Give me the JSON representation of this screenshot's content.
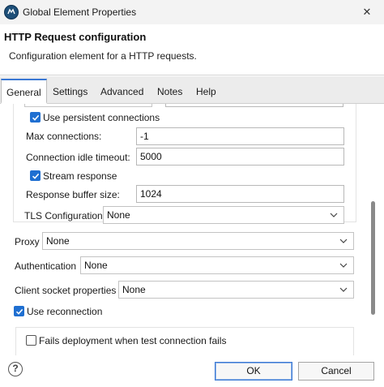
{
  "window": {
    "title": "Global Element Properties",
    "close_glyph": "✕"
  },
  "header": {
    "title": "HTTP Request configuration",
    "description": "Configuration element for a HTTP requests."
  },
  "tabs": [
    {
      "label": "General",
      "active": true
    },
    {
      "label": "Settings",
      "active": false
    },
    {
      "label": "Advanced",
      "active": false
    },
    {
      "label": "Notes",
      "active": false
    },
    {
      "label": "Help",
      "active": false
    }
  ],
  "form": {
    "use_persistent_connections": {
      "label": "Use persistent connections",
      "checked": true
    },
    "max_connections": {
      "label": "Max connections:",
      "value": "-1"
    },
    "connection_idle_timeout": {
      "label": "Connection idle timeout:",
      "value": "5000"
    },
    "stream_response": {
      "label": "Stream response",
      "checked": true
    },
    "response_buffer_size": {
      "label": "Response buffer size:",
      "value": "1024"
    },
    "tls_configuration": {
      "label": "TLS Configuration",
      "value": "None"
    },
    "proxy": {
      "label": "Proxy",
      "value": "None"
    },
    "authentication": {
      "label": "Authentication",
      "value": "None"
    },
    "client_socket_properties": {
      "label": "Client socket properties",
      "value": "None"
    },
    "use_reconnection": {
      "label": "Use reconnection",
      "checked": true
    },
    "fails_deployment": {
      "label": "Fails deployment when test connection fails",
      "checked": false
    }
  },
  "footer": {
    "help_glyph": "?",
    "ok_label": "OK",
    "cancel_label": "Cancel"
  },
  "colors": {
    "accent": "#1f6fd1",
    "app_icon": "#1e4f78"
  },
  "icons": {
    "app": "mule-app-icon",
    "close": "close-icon",
    "help": "help-icon",
    "chevron": "chevron-down-icon",
    "checkmark": "checkmark-icon"
  }
}
